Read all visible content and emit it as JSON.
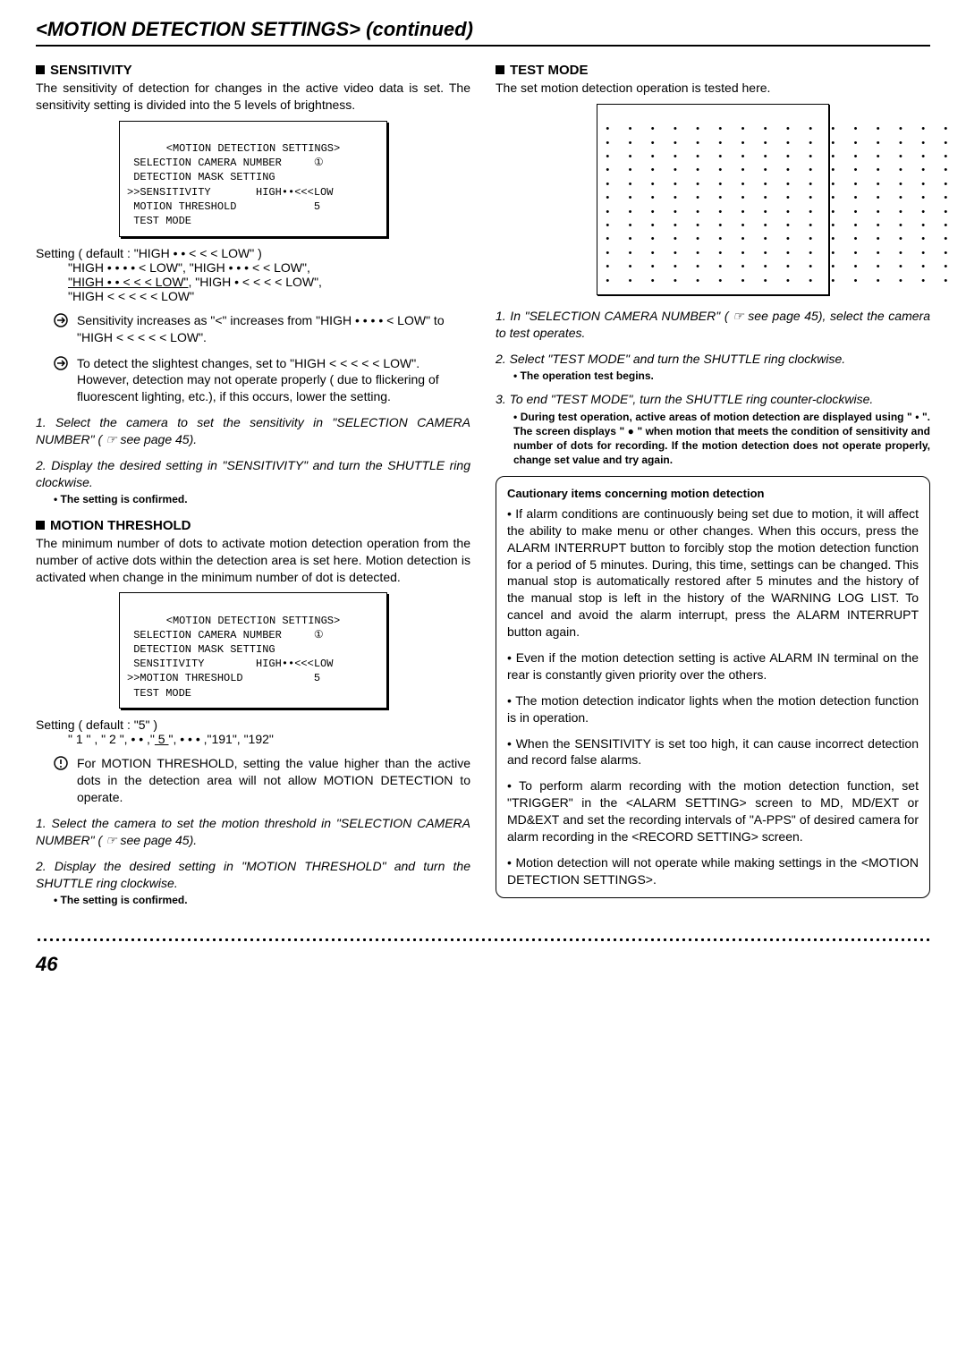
{
  "page_title": "<MOTION DETECTION SETTINGS> (continued)",
  "page_number": "46",
  "sensitivity": {
    "heading": "SENSITIVITY",
    "intro": "The sensitivity of detection for changes in the active video data is set. The sensitivity setting is divided into the 5 levels of brightness.",
    "screen_title": "<MOTION DETECTION SETTINGS>",
    "screen_l1": " SELECTION CAMERA NUMBER     ①",
    "screen_l2": " DETECTION MASK SETTING",
    "screen_l3": ">>SENSITIVITY       HIGH••<<<LOW",
    "screen_l4": " MOTION THRESHOLD            5",
    "screen_l5": " TEST MODE",
    "setting_label": "Setting ( default : \"HIGH • • < < < LOW\" )",
    "opt1": "\"HIGH • • • • < LOW\", \"HIGH • • • < < LOW\",",
    "opt2_a": "\"HIGH • • < < < LOW\"",
    "opt2_b": ", \"HIGH • < < < < LOW\",",
    "opt3": "\"HIGH < < < < < LOW\"",
    "tip1": "Sensitivity increases as \"<\" increases from \"HIGH • • • • < LOW\" to \"HIGH < < < < < LOW\".",
    "tip2": "To detect the slightest changes, set to \"HIGH < < < < < LOW\". However, detection may not operate properly ( due to flickering of fluorescent lighting, etc.), if this occurs, lower the setting.",
    "step1": "1. Select the camera to set the sensitivity in \"SELECTION CAMERA NUMBER\" ( ☞ see page 45).",
    "step2": "2. Display the desired setting in \"SENSITIVITY\" and turn the SHUTTLE ring clockwise.",
    "confirm": "• The setting is confirmed."
  },
  "motion_threshold": {
    "heading": "MOTION THRESHOLD",
    "intro": "The minimum number of dots to activate motion detection operation from the number of active dots within the detection area is set here. Motion detection is activated when change in the minimum number of dot is detected.",
    "screen_title": "<MOTION DETECTION SETTINGS>",
    "screen_l1": " SELECTION CAMERA NUMBER     ①",
    "screen_l2": " DETECTION MASK SETTING",
    "screen_l3": " SENSITIVITY        HIGH••<<<LOW",
    "screen_l4": ">>MOTION THRESHOLD           5",
    "screen_l5": " TEST MODE",
    "setting_label": "Setting ( default : \"5\" )",
    "opt_a": "\" 1 \" , \" 2 \", • • ,\"",
    "opt_mid": " 5 ",
    "opt_b": "\", • • • ,\"191\", \"192\"",
    "warn": "For MOTION THRESHOLD, setting the value higher than the active dots in the detection area will not allow MOTION DETECTION to operate.",
    "step1": "1. Select the camera to set the motion threshold in \"SELECTION CAMERA NUMBER\" ( ☞ see page 45).",
    "step2": "2. Display the desired setting in \"MOTION THRESHOLD\" and turn the SHUTTLE ring clockwise.",
    "confirm": "• The setting is confirmed."
  },
  "test_mode": {
    "heading": "TEST MODE",
    "intro": "The set motion detection operation is tested here.",
    "dot_row": "• • • • • • • • • • • • • • • •",
    "step1": "1. In \"SELECTION CAMERA NUMBER\" ( ☞ see page 45), select the camera to test operates.",
    "step2": "2. Select \"TEST MODE\" and turn the SHUTTLE ring clockwise.",
    "step2_sub": "• The operation test begins.",
    "step3": "3. To end \"TEST MODE\", turn the SHUTTLE ring counter-clockwise.",
    "step3_sub": "• During test operation, active areas of motion detection are displayed using \" • \". The screen displays \" ● \" when motion that meets the condition of sensitivity and number of dots for recording. If the motion detection does not operate properly, change set value and try again.",
    "caution_heading": "Cautionary items concerning motion detection",
    "c1": "• If alarm conditions are continuously being set due to motion, it will affect the ability to make menu or other changes. When this occurs, press the ALARM INTERRUPT button to forcibly stop the motion detection function for a period of 5 minutes. During, this time, settings can be changed. This manual stop is automatically restored after 5 minutes and the history of the manual stop is left in the history of the WARNING LOG LIST. To cancel and avoid the alarm interrupt, press the ALARM INTERRUPT button again.",
    "c2": "• Even if the motion detection setting is active ALARM IN terminal on the rear is constantly given priority over the others.",
    "c3": "• The motion detection indicator lights when the motion detection function is in operation.",
    "c4": "• When the SENSITIVITY is set too high, it can cause incorrect detection and record false alarms.",
    "c5": "• To perform alarm recording with the motion detection function, set \"TRIGGER\" in the <ALARM SETTING> screen to MD, MD/EXT or MD&EXT and set the recording intervals of \"A-PPS\" of desired camera for alarm recording in the <RECORD SETTING> screen.",
    "c6": "• Motion detection will not operate while making settings in the <MOTION DETECTION SETTINGS>."
  }
}
